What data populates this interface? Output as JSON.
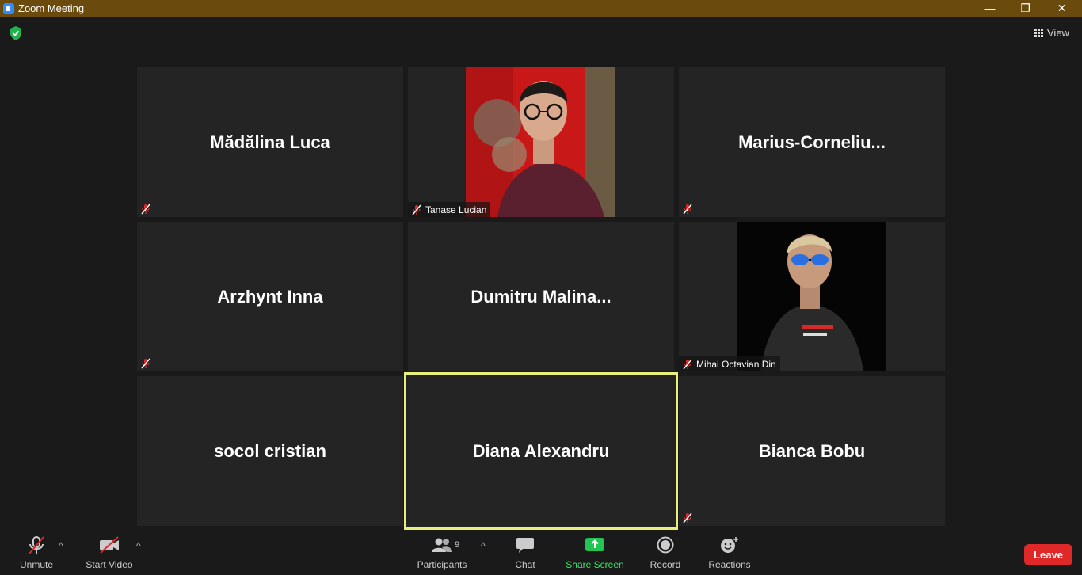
{
  "window": {
    "title": "Zoom Meeting",
    "minimize": "—",
    "maximize": "❐",
    "close": "✕"
  },
  "header": {
    "view_label": "View"
  },
  "tiles": [
    {
      "name": "Mădălina Luca",
      "muted": true
    },
    {
      "name": "Tanase Lucian",
      "muted": true,
      "video": true
    },
    {
      "name": "Marius-Corneliu...",
      "muted": true
    },
    {
      "name": "Arzhynt Inna",
      "muted": true
    },
    {
      "name": "Dumitru  Malina...",
      "muted": false
    },
    {
      "name": "Mihai Octavian Din",
      "muted": true,
      "video": true
    },
    {
      "name": "socol cristian",
      "muted": false
    },
    {
      "name": "Diana Alexandru",
      "muted": false,
      "active_speaker": true
    },
    {
      "name": "Bianca Bobu",
      "muted": true
    }
  ],
  "toolbar": {
    "unmute": "Unmute",
    "start_video": "Start Video",
    "participants": "Participants",
    "participant_count": "9",
    "chat": "Chat",
    "share_screen": "Share Screen",
    "record": "Record",
    "reactions": "Reactions",
    "leave": "Leave"
  },
  "colors": {
    "titlebar": "#6b4a0e",
    "background": "#1a1a1a",
    "tile": "#242424",
    "active_speaker": "#e6f07a",
    "share_green": "#3fe36b",
    "leave_red": "#e02828",
    "muted_red": "#e02828"
  }
}
